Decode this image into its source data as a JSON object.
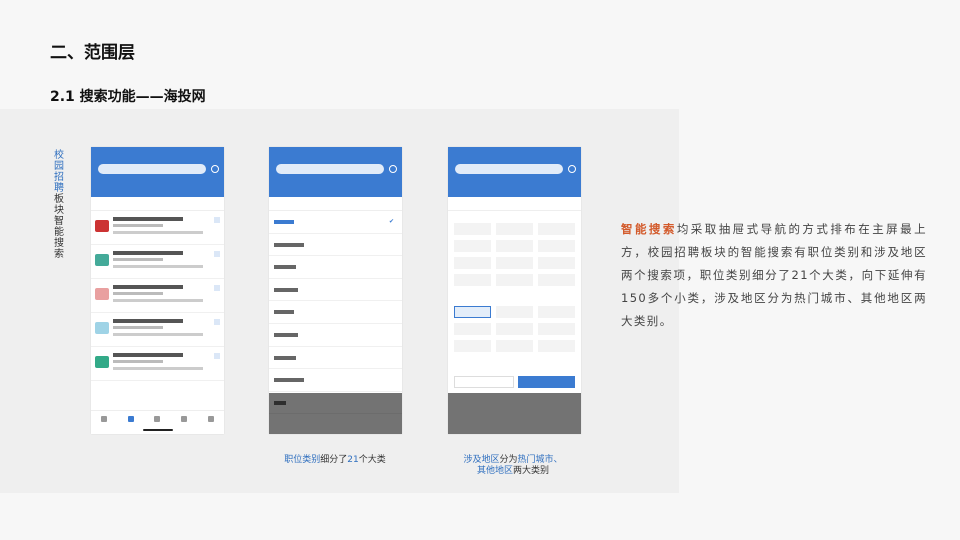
{
  "section_title": "二、范围层",
  "sub_title": "2.1 搜索功能——海投网",
  "vertical_label": {
    "highlight": [
      "校",
      "园",
      "招",
      "聘"
    ],
    "rest": [
      "板",
      "块",
      "智",
      "能",
      "搜",
      "索"
    ]
  },
  "captions": {
    "left": {
      "pre": "职位类别",
      "mid": "细分了",
      "num": "21",
      "post": "个大类"
    },
    "right": {
      "line1_pre": "涉及地区",
      "line1_mid": "分为",
      "line1_hl": "热门城市、",
      "line2_hl": "其他地区",
      "line2_post": "两大类别"
    }
  },
  "paragraph": {
    "highlight": "智能搜索",
    "text": "均采取抽屉式导航的方式排布在主屏最上方，校园招聘板块的智能搜索有职位类别和涉及地区两个搜索项，职位类别细分了21个大类，向下延伸有150多个小类，涉及地区分为热门城市、其他地区两大类别。"
  },
  "colors": {
    "brand_blue": "#3b7bd1",
    "highlight_orange": "#d35b2c"
  }
}
